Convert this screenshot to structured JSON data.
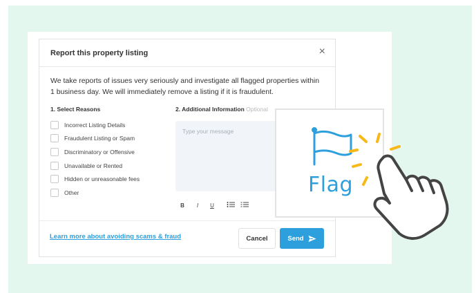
{
  "modal": {
    "title": "Report this property listing",
    "close_glyph": "×",
    "intro": "We take reports of issues very seriously and investigate all flagged properties within 1 business day. We will immediately remove a listing if it is fraudulent."
  },
  "reasons": {
    "title": "1. Select Reasons",
    "items": [
      "Incorrect Listing Details",
      "Fraudulent Listing or Spam",
      "Discriminatory or Offensive",
      "Unavailable or Rented",
      "Hidden or unreasonable fees",
      "Other"
    ]
  },
  "additional": {
    "title": "2. Additional Information",
    "optional": "Optional",
    "placeholder": "Type your message"
  },
  "toolbar": {
    "bold": "B",
    "italic": "I",
    "underline": "U"
  },
  "footer": {
    "learn_link": "Learn more about avoiding scams & fraud",
    "cancel_label": "Cancel",
    "send_label": "Send"
  },
  "flag_card": {
    "label": "Flag"
  },
  "colors": {
    "accent": "#2d9fdc",
    "spark": "#f7b818",
    "background": "#e4f7ef"
  }
}
